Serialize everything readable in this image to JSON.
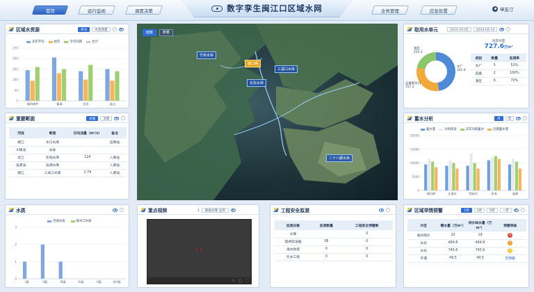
{
  "header": {
    "title": "数字孪生闽江口区域水网",
    "nav_left": [
      "首页",
      "运行监视",
      "调度决策"
    ],
    "nav_right": [
      "业务管理",
      "应急处置"
    ],
    "user": "申友汀"
  },
  "map": {
    "tabs": [
      "面板",
      "数量"
    ],
    "labels": [
      "竹岐水库",
      "塘口闸",
      "三溪口水库",
      "东张水库",
      "二十八都水库"
    ]
  },
  "panel_water_resources": {
    "title": "区域水资源",
    "toggles": [
      "月汛",
      "水资源量"
    ],
    "legend": [
      "多年平均",
      "枯年",
      "今年同期",
      "合计"
    ],
    "chart_data": {
      "type": "bar",
      "title": "",
      "ylabel": "",
      "categories": [
        "福州南片",
        "福清",
        "长乐",
        "连江"
      ],
      "ylim": [
        0,
        250
      ],
      "yticks": [
        "0",
        "50",
        "100",
        "150",
        "200",
        "250"
      ],
      "series": [
        {
          "name": "多年平均",
          "color": "#7fa8de",
          "values": [
            145,
            205,
            140,
            150
          ]
        },
        {
          "name": "枯年",
          "color": "#f6b45d",
          "values": [
            95,
            130,
            100,
            95
          ]
        },
        {
          "name": "今年同期",
          "color": "#9fcf6e",
          "values": [
            160,
            150,
            170,
            140
          ]
        },
        {
          "name": "合计",
          "color": "#c3c9d3",
          "values": []
        }
      ]
    }
  },
  "panel_sections": {
    "title": "重要断面",
    "toggles": [
      "水质",
      "流量"
    ],
    "columns": [
      "河流",
      "断面",
      "日均流量（m³/s）",
      "备注"
    ],
    "rows": [
      [
        "闽江",
        "水口水库",
        "",
        "出库站"
      ],
      [
        "大樟溪",
        "永泰",
        "",
        ""
      ],
      [
        "龙江",
        "东张水库",
        "124",
        "入库站"
      ],
      [
        "溪源溪",
        "溪源水库",
        "",
        "入库站"
      ],
      [
        "闽江",
        "三溪口水库",
        "2.74",
        "入库站"
      ]
    ]
  },
  "panel_quality": {
    "title": "水质",
    "legend": [
      "河湖水质",
      "取水口水质"
    ],
    "chart_data": {
      "type": "bar",
      "title": "",
      "ylabel": "",
      "categories": [
        "I类",
        "II类",
        "III类",
        "IV类",
        "V类",
        "劣V类"
      ],
      "ylim": [
        0,
        3
      ],
      "yticks": [
        "0",
        "1",
        "2",
        "3"
      ],
      "series": [
        {
          "name": "河湖水质",
          "color": "#7fa8de",
          "values": [
            1,
            2,
            1,
            0,
            0,
            0
          ]
        },
        {
          "name": "取水口水质",
          "color": "#9fcf6e",
          "values": [
            0,
            0,
            0,
            0,
            0,
            0
          ]
        }
      ]
    }
  },
  "panel_video": {
    "title": "重点视频",
    "select": "闽福水库-主坝"
  },
  "panel_safety": {
    "title": "工程安全监测",
    "columns": [
      "监测对象",
      "监测数量",
      "工程安全预警数"
    ],
    "rows": [
      [
        "水库",
        "",
        "0"
      ],
      [
        "堤闸前设备",
        "58",
        "0"
      ],
      [
        "海水防控",
        "0",
        "0"
      ],
      [
        "引水工程",
        "0",
        "0"
      ]
    ]
  },
  "panel_intake": {
    "title": "取用水单元",
    "date_from": "2024-10-01",
    "date_to": "2024-04-14",
    "total_label": "总取水量",
    "total_value": "727.6",
    "total_unit": "万m³",
    "pie_labels": [
      "源区 224.3",
      "自备取水口 157.2",
      "水厂 345.9"
    ],
    "columns": [
      "类别",
      "数量",
      "监测率"
    ],
    "rows": [
      [
        "水厂",
        "5",
        "52%"
      ],
      [
        "自备",
        "2",
        "100%"
      ],
      [
        "源区",
        "6",
        "70%"
      ]
    ],
    "chart_data": {
      "type": "pie",
      "categories": [
        "水厂",
        "源区",
        "自备取水口"
      ],
      "values": [
        345.9,
        224.3,
        157.2
      ],
      "colors": [
        "#4e8ad8",
        "#f2a93b",
        "#8cc56a"
      ]
    }
  },
  "panel_storage": {
    "title": "蓄水分析",
    "toggles": [
      "月",
      "年"
    ],
    "legend": [
      "蓄水量",
      "兴利库容",
      "去年同期蓄水",
      "同期蓄水量"
    ],
    "chart_data": {
      "type": "bar",
      "title": "",
      "ylabel": "",
      "categories": [
        "闽口库",
        "三溪口",
        "竹岐口",
        "东张",
        "溪源"
      ],
      "ylim": [
        0,
        20000
      ],
      "yticks": [
        "0",
        "5000",
        "10000",
        "15000",
        "20000"
      ],
      "series": [
        {
          "name": "蓄水量",
          "color": "#6f9ee0",
          "values": [
            9500,
            9000,
            9000,
            11000,
            9500
          ]
        },
        {
          "name": "兴利库容",
          "color": "#e7e9ef",
          "values": [
            11500,
            11000,
            13500,
            12000,
            11500
          ]
        },
        {
          "name": "去年同期蓄水",
          "color": "#9fcf6e",
          "values": [
            10500,
            10000,
            10000,
            12500,
            10500
          ]
        },
        {
          "name": "同期蓄水量",
          "color": "#f6b45d",
          "values": [
            8500,
            8000,
            8000,
            11500,
            8000
          ]
        }
      ]
    }
  },
  "panel_drought": {
    "title": "区域旱情预警",
    "toggles": [
      "1月",
      "3月",
      "6月",
      "一年"
    ],
    "columns": [
      "片区",
      "需水量（万m³）",
      "供计缺水量（万m³）",
      "预警等级"
    ],
    "rows": [
      [
        "福州南片",
        "20",
        "19",
        "1"
      ],
      [
        "长乐",
        "484.8",
        "484.8",
        "2"
      ],
      [
        "长乐",
        "745.6",
        "745.6",
        "3"
      ],
      [
        "平潭",
        "49.5",
        "49.5",
        "无预警"
      ]
    ],
    "level_colors": [
      "#e34b3c",
      "#ef9b2a",
      "#f2c530"
    ]
  }
}
